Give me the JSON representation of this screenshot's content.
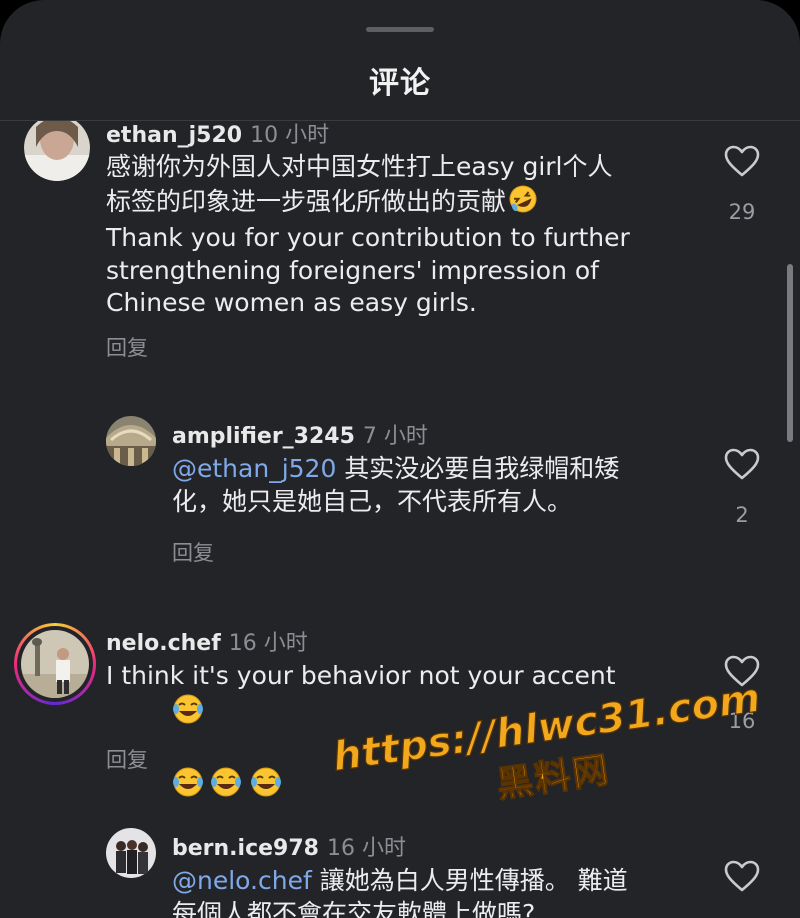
{
  "header": {
    "title": "评论"
  },
  "comments": [
    {
      "username": "ethan_j520",
      "time": "10 小时",
      "text": "感谢你为外国人对中国女性打上easy girl个人\n标签的印象进一步强化所做出的贡献",
      "text_en": "Thank you for your contribution to further\nstrengthening foreigners' impression of\nChinese women as easy girls.",
      "reply_label": "回复",
      "likes": "29"
    },
    {
      "username": "amplifier_3245",
      "time": "7 小时",
      "mention": "@ethan_j520",
      "text": " 其实没必要自我绿帽和矮\n化，她只是她自己，不代表所有人。",
      "reply_label": "回复",
      "likes": "2"
    },
    {
      "username": "nelo.chef",
      "time": "16 小时",
      "text": "I think it's your behavior not your accent",
      "reply_label": "回复",
      "likes": "16"
    },
    {
      "username": "bern.ice978",
      "time": "16 小时",
      "mention": "@nelo.chef",
      "text": " 讓她為白人男性傳播。 難道\n每個人都不會在交友軟體上做嗎?"
    }
  ],
  "watermark": {
    "url": "https://hlwc31.com",
    "name": "黑料网"
  },
  "colors": {
    "background": "#232428",
    "mention": "#7fa9e8",
    "watermark": "#f2a81d"
  }
}
